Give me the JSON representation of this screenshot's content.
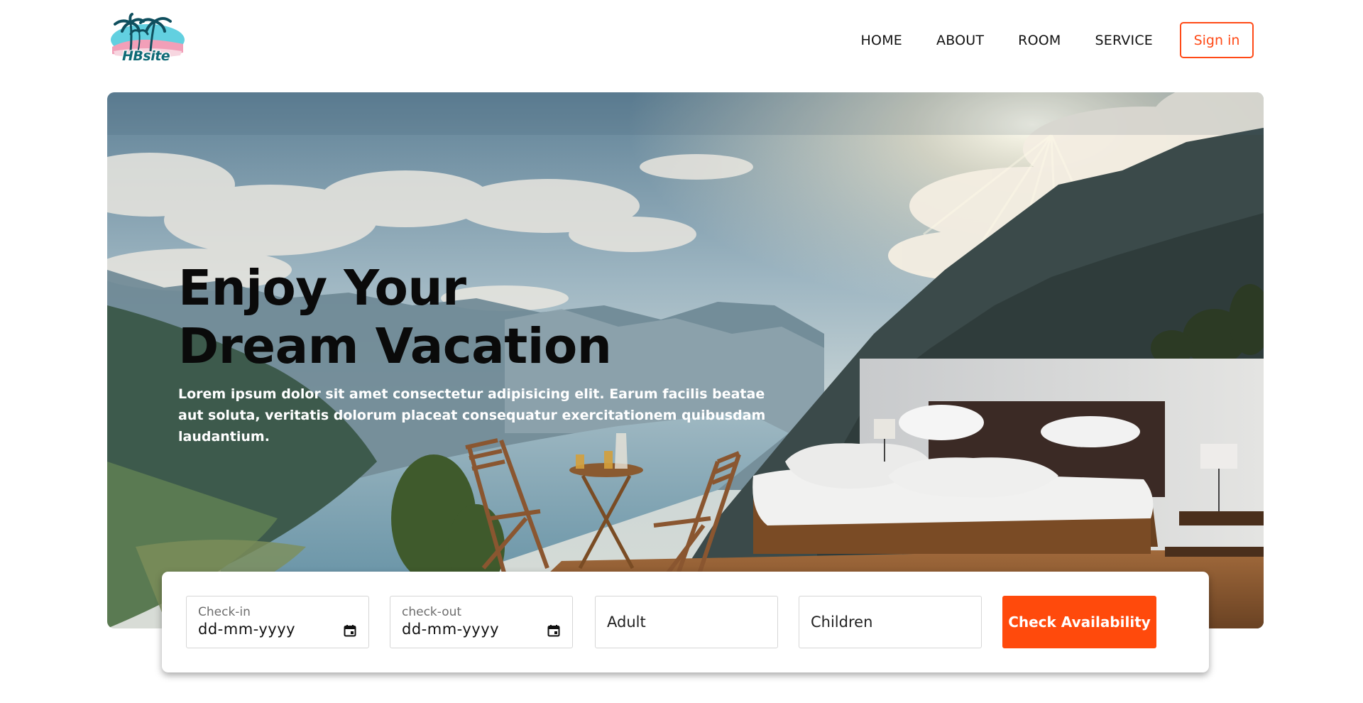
{
  "brand": {
    "logo_text": "HBsite"
  },
  "nav": {
    "items": [
      {
        "label": "HOME"
      },
      {
        "label": "ABOUT"
      },
      {
        "label": "ROOM"
      },
      {
        "label": "SERVICE"
      }
    ],
    "signin_label": "Sign in"
  },
  "hero": {
    "title_line1": "Enjoy Your",
    "title_line2": "Dream Vacation",
    "description": "Lorem ipsum dolor sit amet consectetur adipisicing elit. Earum facilis beatae aut soluta, veritatis dolorum placeat consequatur exercitationem quibusdam laudantium."
  },
  "booking": {
    "checkin": {
      "label": "Check-in",
      "value": "dd-mm-yyyy"
    },
    "checkout": {
      "label": "check-out",
      "value": "dd-mm-yyyy"
    },
    "adult_placeholder": "Adult",
    "children_placeholder": "Children",
    "button_label": "Check Availability"
  },
  "colors": {
    "accent": "#ff4a17",
    "button": "#ff4a0c",
    "logo_text": "#0f6a76"
  }
}
